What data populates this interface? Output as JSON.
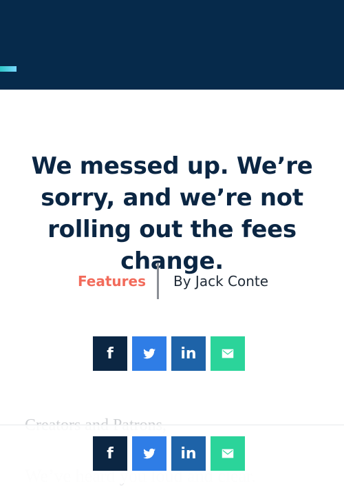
{
  "article": {
    "title": "We messed up. We’re sorry, and we’re not rolling out the fees change.",
    "category": "Features",
    "author": "By Jack Conte"
  },
  "share": {
    "facebook": "f",
    "twitter": "twitter-bird",
    "linkedin": "in",
    "email": "envelope"
  },
  "excerpt": {
    "salutation": "Creators and Patrons,",
    "line": "We’ve heard you loud and clear."
  },
  "colors": {
    "header_bg": "#062a4b",
    "category": "#f26b5b",
    "facebook": "#0b2643",
    "twitter": "#2f7de6",
    "linkedin": "#1e63a8",
    "email": "#2bd49a"
  }
}
